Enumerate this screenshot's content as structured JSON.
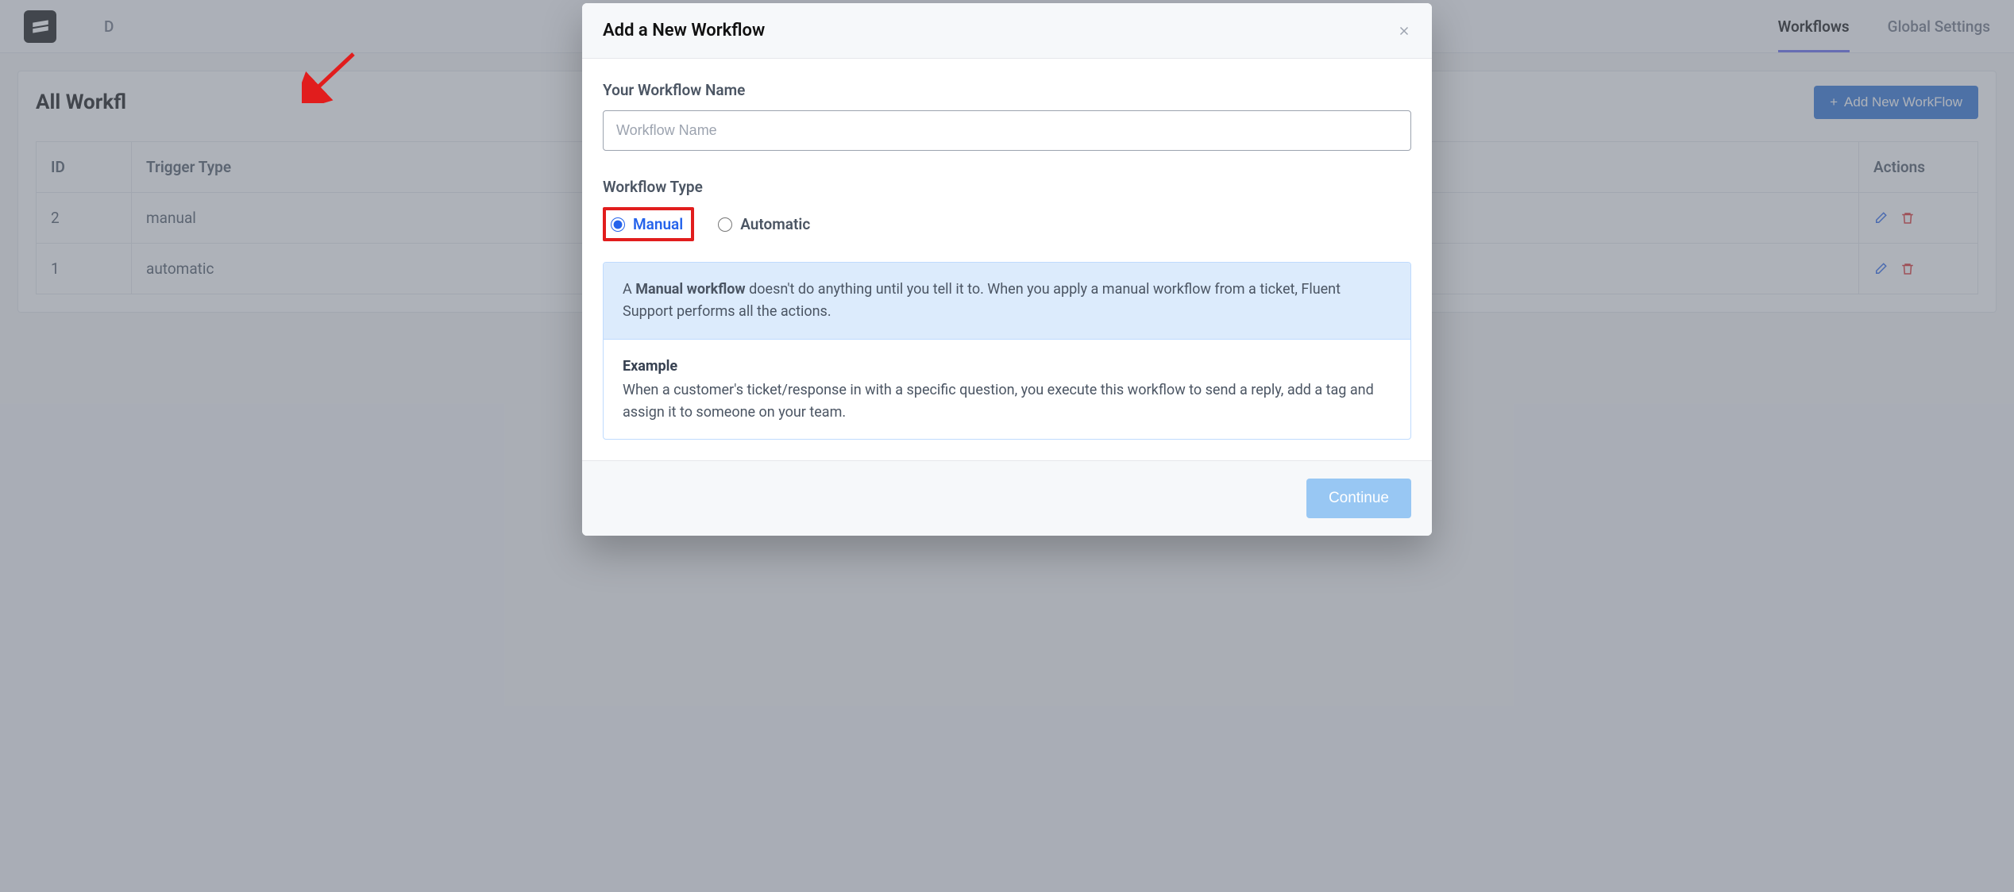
{
  "nav": {
    "stub_left": "D",
    "workflows": "Workflows",
    "global_settings": "Global Settings"
  },
  "page": {
    "title": "All Workfl",
    "add_button": "Add New WorkFlow"
  },
  "table": {
    "headers": {
      "id": "ID",
      "trigger_type": "Trigger Type",
      "actions": "Actions"
    },
    "rows": [
      {
        "id": "2",
        "trigger_type": "manual"
      },
      {
        "id": "1",
        "trigger_type": "automatic"
      }
    ]
  },
  "modal": {
    "title": "Add a New Workflow",
    "name_label": "Your Workflow Name",
    "name_placeholder": "Workflow Name",
    "type_label": "Workflow Type",
    "type_options": {
      "manual": "Manual",
      "automatic": "Automatic"
    },
    "selected_type": "manual",
    "info": {
      "desc_prefix": "A ",
      "desc_strong": "Manual workflow",
      "desc_rest": " doesn't do anything until you tell it to. When you apply a manual workflow from a ticket, Fluent Support performs all the actions.",
      "example_title": "Example",
      "example_body": "When a customer's ticket/response in with a specific question, you execute this workflow to send a reply, add a tag and assign it to someone on your team."
    },
    "continue": "Continue"
  },
  "colors": {
    "accent_blue": "#2563eb",
    "highlight_red": "#e11d1d",
    "button_blue": "#2970d6",
    "continue_disabled": "#98c7f3"
  }
}
